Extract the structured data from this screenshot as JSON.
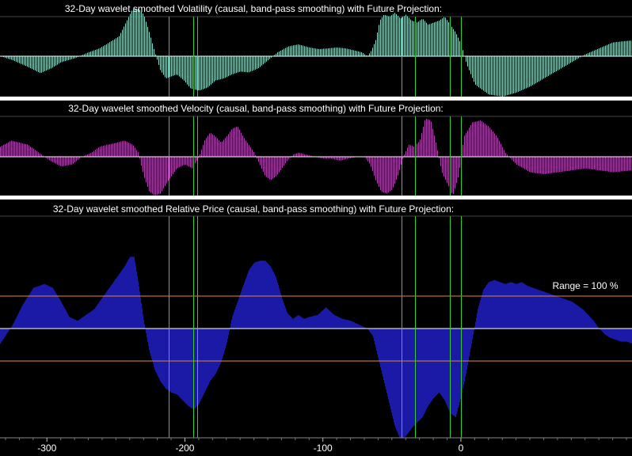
{
  "colors": {
    "background": "#000000",
    "separator": "#ffffff",
    "volatility": "#7fe0d0",
    "velocity": "#b33cb3",
    "price": "#1a1aa6",
    "price_edge": "#3a3ad8",
    "marker": "#33cc33",
    "range_line": "#e08a3c",
    "zero_line": "#ffffff",
    "text": "#ffffff"
  },
  "chart_data": [
    {
      "type": "bar",
      "title": "32-Day wavelet smoothed Volatility (causal, band-pass smoothing) with Future Projection:",
      "xlim": [
        -334,
        124
      ],
      "ylim": [
        -1,
        1
      ],
      "series": [
        {
          "x": [
            -334,
            -325,
            -315,
            -305,
            -297,
            -290,
            -280,
            -270,
            -262,
            -255,
            -248,
            -243,
            -238,
            -234,
            -230,
            -226,
            -222,
            -218,
            -214,
            -210,
            -206,
            -201,
            -196,
            -190,
            -184,
            -178,
            -172,
            -166,
            -160,
            -154,
            -147,
            -140,
            -133,
            -125,
            -118,
            -110,
            -103,
            -96,
            -90,
            -84,
            -78,
            -72,
            -68,
            -65,
            -62,
            -59,
            -56,
            -52,
            -48,
            -44,
            -40,
            -36,
            -32,
            -28,
            -24,
            -20,
            -16,
            -12,
            -8,
            -4,
            0,
            4,
            10,
            20,
            30,
            40,
            50,
            60,
            70,
            80,
            90,
            100,
            110,
            124
          ],
          "values": [
            0.0,
            -0.1,
            -0.25,
            -0.42,
            -0.3,
            -0.15,
            -0.05,
            0.1,
            0.2,
            0.35,
            0.5,
            0.85,
            1.2,
            1.2,
            1.05,
            0.6,
            0.1,
            -0.35,
            -0.55,
            -0.5,
            -0.45,
            -0.6,
            -0.8,
            -0.85,
            -0.78,
            -0.6,
            -0.55,
            -0.45,
            -0.38,
            -0.4,
            -0.3,
            -0.1,
            0.1,
            0.25,
            0.3,
            0.22,
            0.18,
            0.2,
            0.22,
            0.2,
            0.15,
            0.1,
            0.0,
            0.15,
            0.4,
            0.9,
            1.05,
            1.0,
            1.1,
            0.95,
            1.05,
            0.9,
            0.85,
            0.95,
            0.8,
            0.85,
            0.9,
            1.0,
            0.8,
            0.6,
            0.3,
            -0.2,
            -0.7,
            -0.95,
            -1.0,
            -0.9,
            -0.75,
            -0.55,
            -0.35,
            -0.15,
            0.05,
            0.2,
            0.35,
            0.4
          ]
        }
      ]
    },
    {
      "type": "bar",
      "title": "32-Day wavelet smoothed Velocity (causal, band-pass smoothing) with Future Projection:",
      "xlim": [
        -334,
        124
      ],
      "ylim": [
        -1,
        1
      ],
      "series": [
        {
          "x": [
            -334,
            -326,
            -320,
            -314,
            -306,
            -298,
            -290,
            -282,
            -275,
            -268,
            -262,
            -256,
            -250,
            -244,
            -238,
            -234,
            -230,
            -226,
            -222,
            -218,
            -212,
            -206,
            -200,
            -195,
            -190,
            -186,
            -182,
            -178,
            -174,
            -170,
            -166,
            -162,
            -158,
            -154,
            -150,
            -146,
            -142,
            -138,
            -134,
            -130,
            -126,
            -122,
            -118,
            -112,
            -106,
            -100,
            -94,
            -88,
            -82,
            -76,
            -70,
            -66,
            -62,
            -58,
            -54,
            -50,
            -46,
            -42,
            -38,
            -34,
            -30,
            -26,
            -22,
            -18,
            -14,
            -10,
            -6,
            -2,
            2,
            8,
            14,
            20,
            26,
            32,
            40,
            50,
            60,
            70,
            80,
            90,
            100,
            110,
            124
          ],
          "values": [
            0.25,
            0.4,
            0.35,
            0.3,
            0.1,
            -0.1,
            -0.25,
            -0.2,
            0.0,
            0.1,
            0.25,
            0.3,
            0.35,
            0.4,
            0.3,
            0.1,
            -0.5,
            -0.9,
            -1.0,
            -0.95,
            -0.6,
            -0.3,
            -0.2,
            -0.3,
            0.0,
            0.4,
            0.6,
            0.5,
            0.35,
            0.5,
            0.7,
            0.75,
            0.5,
            0.3,
            0.1,
            -0.2,
            -0.5,
            -0.6,
            -0.5,
            -0.3,
            -0.1,
            0.05,
            0.1,
            0.05,
            0.0,
            -0.05,
            -0.05,
            -0.1,
            -0.05,
            0.0,
            0.0,
            -0.2,
            -0.6,
            -0.9,
            -0.95,
            -0.85,
            -0.5,
            0.0,
            0.3,
            0.25,
            0.4,
            0.95,
            0.9,
            0.3,
            -0.4,
            -0.7,
            -1.0,
            -0.5,
            0.5,
            0.85,
            0.9,
            0.75,
            0.5,
            0.1,
            -0.2,
            -0.4,
            -0.45,
            -0.4,
            -0.35,
            -0.3,
            -0.35,
            -0.4,
            -0.35
          ]
        }
      ]
    },
    {
      "type": "area",
      "title": "32-Day wavelet smoothed Relative Price (causal, band-pass smoothing) with Future Projection:",
      "annotation": "Range = 100 %",
      "xlim": [
        -334,
        124
      ],
      "ylim": [
        -2.9,
        2.9
      ],
      "x_ticks": [
        -300,
        -200,
        -100,
        0
      ],
      "x_tick_labels": [
        "-300",
        "-200",
        "-100",
        "0"
      ],
      "range_band": [
        -1,
        1
      ],
      "series": [
        {
          "x": [
            -334,
            -325,
            -318,
            -310,
            -302,
            -296,
            -290,
            -284,
            -278,
            -272,
            -266,
            -260,
            -254,
            -248,
            -244,
            -240,
            -237,
            -234,
            -230,
            -226,
            -222,
            -218,
            -214,
            -210,
            -206,
            -202,
            -198,
            -194,
            -190,
            -186,
            -182,
            -178,
            -174,
            -170,
            -166,
            -162,
            -158,
            -154,
            -150,
            -146,
            -142,
            -138,
            -134,
            -130,
            -126,
            -122,
            -118,
            -114,
            -110,
            -104,
            -98,
            -92,
            -86,
            -80,
            -74,
            -68,
            -64,
            -60,
            -56,
            -52,
            -48,
            -44,
            -40,
            -36,
            -32,
            -28,
            -24,
            -20,
            -16,
            -12,
            -8,
            -4,
            0,
            4,
            8,
            12,
            16,
            20,
            24,
            28,
            32,
            36,
            40,
            44,
            48,
            52,
            56,
            60,
            64,
            68,
            72,
            76,
            80,
            84,
            88,
            92,
            96,
            100,
            104,
            108,
            112,
            116,
            120,
            124
          ],
          "values": [
            -0.4,
            0.1,
            0.6,
            1.05,
            1.15,
            1.05,
            0.7,
            0.3,
            0.2,
            0.35,
            0.5,
            0.8,
            1.1,
            1.4,
            1.6,
            1.85,
            1.85,
            1.2,
            0.2,
            -0.6,
            -1.1,
            -1.4,
            -1.6,
            -1.7,
            -1.75,
            -1.9,
            -2.05,
            -2.15,
            -2.0,
            -1.7,
            -1.4,
            -1.2,
            -0.9,
            -0.4,
            0.3,
            0.7,
            1.1,
            1.5,
            1.7,
            1.75,
            1.75,
            1.6,
            1.3,
            0.8,
            0.4,
            0.25,
            0.35,
            0.25,
            0.3,
            0.35,
            0.55,
            0.35,
            0.25,
            0.2,
            0.1,
            0.0,
            -0.2,
            -0.8,
            -1.4,
            -2.0,
            -2.6,
            -2.95,
            -2.85,
            -2.65,
            -2.5,
            -2.35,
            -2.05,
            -1.85,
            -1.7,
            -1.9,
            -2.25,
            -2.35,
            -1.8,
            -1.1,
            -0.3,
            0.5,
            1.0,
            1.2,
            1.25,
            1.2,
            1.15,
            1.2,
            1.15,
            1.2,
            1.1,
            1.05,
            1.0,
            0.95,
            0.9,
            0.85,
            0.8,
            0.75,
            0.7,
            0.6,
            0.5,
            0.35,
            0.2,
            0.0,
            -0.15,
            -0.25,
            -0.3,
            -0.35,
            -0.35,
            -0.4
          ]
        }
      ]
    }
  ],
  "markers": [
    -212,
    -194,
    -191,
    -43,
    -33,
    -8,
    0
  ]
}
